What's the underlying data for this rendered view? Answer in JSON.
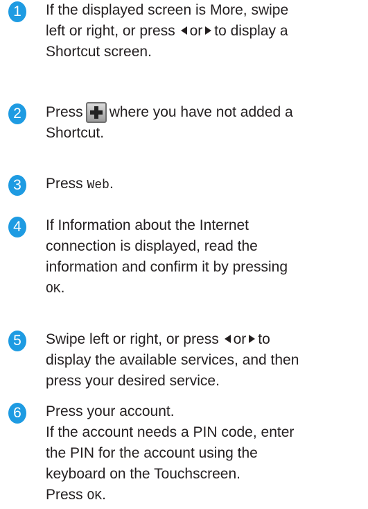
{
  "steps": [
    {
      "number": "1",
      "line1_text": "If the displayed screen is More, swipe",
      "line2_a": "left or right, or press",
      "line2_or": "or",
      "line2_b": "to display a",
      "line3": "Shortcut screen.",
      "icons": [
        "left-arrow-icon",
        "right-arrow-icon"
      ]
    },
    {
      "number": "2",
      "line1_a": "Press",
      "line1_b": "where you have not added a",
      "line2": "Shortcut.",
      "icon": "plus-button-icon"
    },
    {
      "number": "3",
      "line1_a": "Press",
      "line1_mono": "Web",
      "line1_end": "."
    },
    {
      "number": "4",
      "line1": "If Information about the Internet",
      "line2": "connection is displayed, read the",
      "line3": "information and confirm it by pressing",
      "line4_mono": "OK",
      "line4_end": "."
    },
    {
      "number": "5",
      "line1_a": "Swipe left or right, or press",
      "line1_or": "or",
      "line1_b": "to",
      "line2": "display the available services, and then",
      "line3": "press your desired service.",
      "icons": [
        "left-arrow-icon",
        "right-arrow-icon"
      ]
    },
    {
      "number": "6",
      "line1": "Press your account.",
      "line2": "If the account needs a PIN code, enter",
      "line3": "the PIN for the account using the",
      "line4": "keyboard on the Touchscreen.",
      "line5_a": "Press",
      "line5_mono": "OK",
      "line5_end": "."
    }
  ],
  "colors": {
    "badge": "#1e9be2",
    "text": "#231f20"
  }
}
